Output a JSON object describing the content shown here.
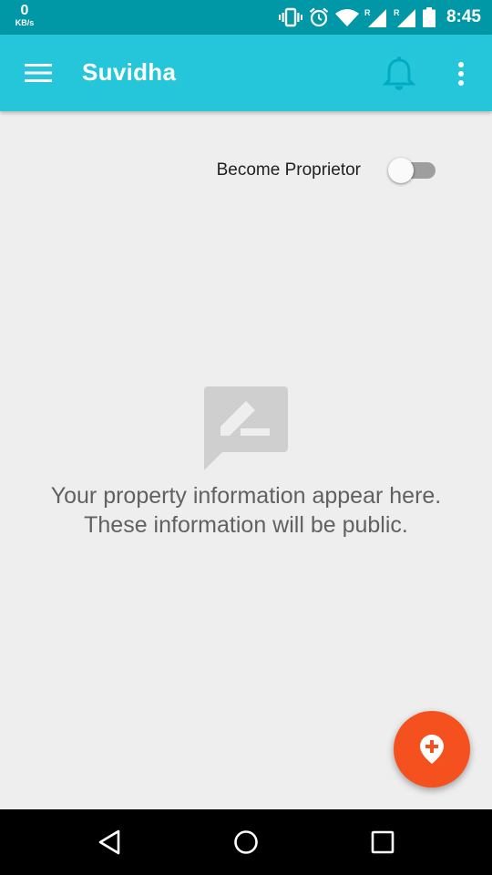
{
  "status_bar": {
    "speed_value": "0",
    "speed_unit": "KB/s",
    "time": "8:45",
    "icons": [
      "vibrate-icon",
      "alarm-icon",
      "wifi-icon",
      "signal-r-icon",
      "signal-r-icon",
      "battery-icon"
    ],
    "roaming_label": "R"
  },
  "app_bar": {
    "title": "Suvidha",
    "menu_icon": "hamburger-menu-icon",
    "notification_icon": "bell-icon",
    "overflow_icon": "more-vert-icon"
  },
  "proprietor_toggle": {
    "label": "Become Proprietor",
    "checked": false
  },
  "empty_state": {
    "icon": "edit-comment-icon",
    "line1": "Your property information appear here.",
    "line2": "These information will be public."
  },
  "fab": {
    "icon": "add-location-icon"
  },
  "navigation_bar": {
    "buttons": [
      "back-icon",
      "home-icon",
      "recents-icon"
    ]
  },
  "colors": {
    "status_bar": "#0097a7",
    "app_bar": "#26c6da",
    "background": "#eeeeee",
    "fab": "#f4511e",
    "bell": "#00acc1"
  }
}
